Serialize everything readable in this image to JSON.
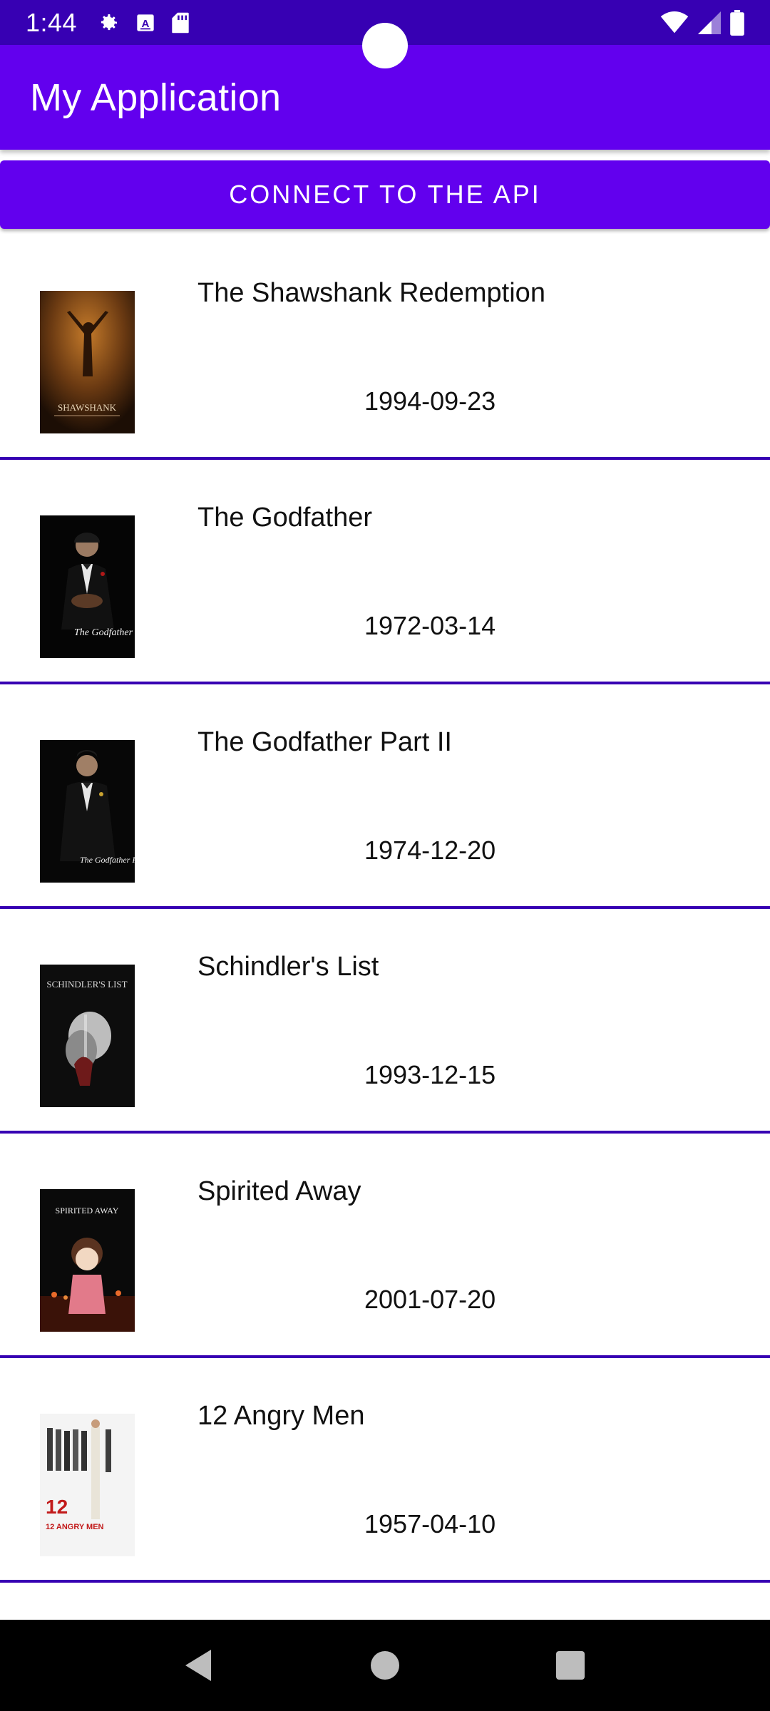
{
  "status_bar": {
    "time": "1:44",
    "left_icons": [
      "gear-icon",
      "a-box-icon",
      "sd-card-icon"
    ],
    "right_icons": [
      "wifi-icon",
      "cell-signal-icon",
      "battery-icon"
    ]
  },
  "app_bar": {
    "title": "My Application",
    "color": "#6200ee"
  },
  "connect_button": {
    "label": "CONNECT TO THE API"
  },
  "movies": [
    {
      "title": "The Shawshank Redemption",
      "date": "1994-09-23",
      "poster_text": "SHAWSHANK"
    },
    {
      "title": "The Godfather",
      "date": "1972-03-14",
      "poster_text": "The Godfather"
    },
    {
      "title": "The Godfather Part II",
      "date": "1974-12-20",
      "poster_text": "The Godfather PART II"
    },
    {
      "title": "Schindler's List",
      "date": "1993-12-15",
      "poster_text": "SCHINDLER'S LIST"
    },
    {
      "title": "Spirited Away",
      "date": "2001-07-20",
      "poster_text": "SPIRITED AWAY"
    },
    {
      "title": "12 Angry Men",
      "date": "1957-04-10",
      "poster_text": "12 ANGRY MEN"
    }
  ],
  "nav_bar": {
    "buttons": [
      "back-icon",
      "home-icon",
      "recents-icon"
    ]
  },
  "colors": {
    "status_bar": "#3700b3",
    "primary": "#6200ee",
    "divider": "#3700b3"
  }
}
